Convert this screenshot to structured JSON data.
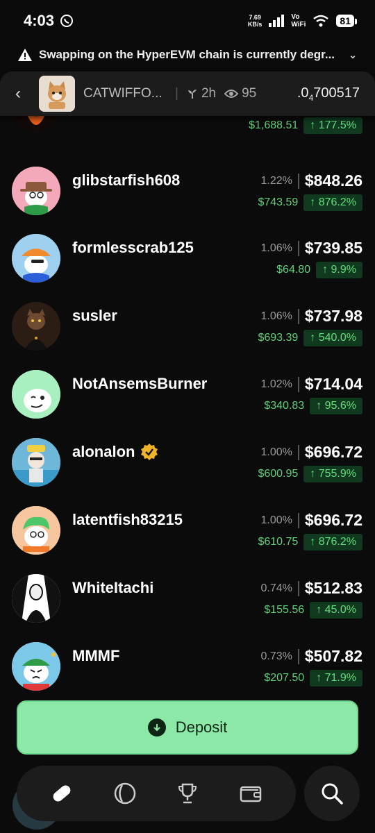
{
  "status": {
    "time": "4:03",
    "net_speed_value": "7.69",
    "net_speed_unit": "KB/s",
    "wifi_label_1": "Vo",
    "wifi_label_2": "WiFi",
    "battery": "81"
  },
  "banner": {
    "text": "Swapping on the HyperEVM chain is currently degr..."
  },
  "token_header": {
    "name": "CATWIFFO...",
    "age": "2h",
    "viewers": "95",
    "price_prefix": ".0",
    "price_sub": "4",
    "price_rest": "700517"
  },
  "partial_row": {
    "pnl": "$1,688.51",
    "gain": "↑ 177.5%"
  },
  "holders": [
    {
      "name": "glibstarfish608",
      "pct": "1.22%",
      "value": "$848.26",
      "pnl": "$743.59",
      "gain": "↑ 876.2%",
      "avatar": "cowboy-hat"
    },
    {
      "name": "formlesscrab125",
      "pct": "1.06%",
      "value": "$739.85",
      "pnl": "$64.80",
      "gain": "↑ 9.9%",
      "avatar": "cap-sunglasses"
    },
    {
      "name": "susler",
      "pct": "1.06%",
      "value": "$737.98",
      "pnl": "$693.39",
      "gain": "↑ 540.0%",
      "avatar": "dark-cat"
    },
    {
      "name": "NotAnsemsBurner",
      "pct": "1.02%",
      "value": "$714.04",
      "pnl": "$340.83",
      "gain": "↑ 95.6%",
      "avatar": "wink"
    },
    {
      "name": "alonalon",
      "verified": true,
      "pct": "1.00%",
      "value": "$696.72",
      "pnl": "$600.95",
      "gain": "↑ 755.9%",
      "avatar": "pool"
    },
    {
      "name": "latentfish83215",
      "pct": "1.00%",
      "value": "$696.72",
      "pnl": "$610.75",
      "gain": "↑ 876.2%",
      "avatar": "green-hair"
    },
    {
      "name": "WhiteItachi",
      "pct": "0.74%",
      "value": "$512.83",
      "pnl": "$155.56",
      "gain": "↑ 45.0%",
      "avatar": "bw-anime"
    },
    {
      "name": "MMMF",
      "pct": "0.73%",
      "value": "$507.82",
      "pnl": "$207.50",
      "gain": "↑ 71.9%",
      "avatar": "green-bandana"
    }
  ],
  "deposit": {
    "label": "Deposit"
  },
  "nav": {
    "items": [
      "pill-icon",
      "circle-icon",
      "trophy-icon",
      "wallet-icon"
    ],
    "search": "search-icon"
  },
  "colors": {
    "background": "#0b0b0b",
    "gain_green": "#5fe07a",
    "deposit_green": "#8ce9a8"
  }
}
